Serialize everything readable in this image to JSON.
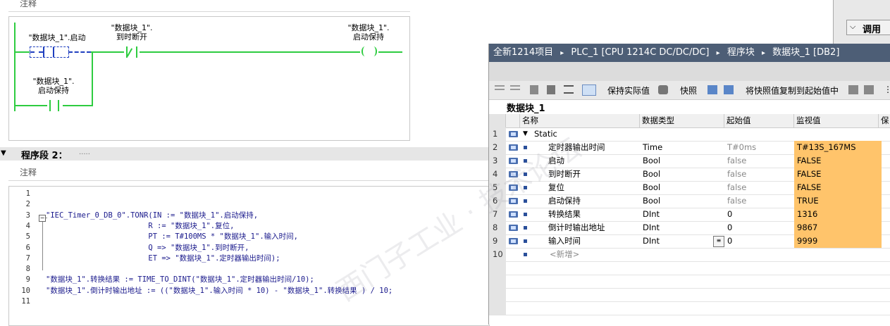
{
  "segment1": {
    "comment_label": "注释",
    "contact_start_l1": "\"数据块_1\".启动",
    "contact_stop_l1": "\"数据块_1\".",
    "contact_stop_l2": "到时断开",
    "coil_l1": "\"数据块_1\".",
    "coil_l2": "启动保持",
    "branch_l1": "\"数据块_1\".",
    "branch_l2": "启动保持"
  },
  "segment2": {
    "title": "程序段 2：",
    "title_suffix": ".....",
    "comment_label": "注释",
    "code_lines": [
      {
        "num": "1",
        "text": ""
      },
      {
        "num": "2",
        "text": ""
      },
      {
        "num": "3",
        "text": "\"IEC_Timer_0_DB_0\".TONR(IN := \"数据块_1\".启动保持,"
      },
      {
        "num": "4",
        "text": "                       R := \"数据块_1\".复位,"
      },
      {
        "num": "5",
        "text": "                       PT := T#100MS * \"数据块_1\".输入时间,"
      },
      {
        "num": "6",
        "text": "                       Q => \"数据块_1\".到时断开,"
      },
      {
        "num": "7",
        "text": "                       ET => \"数据块_1\".定时器输出时间);"
      },
      {
        "num": "8",
        "text": ""
      },
      {
        "num": "9",
        "text": "\"数据块_1\".转换结果 := TIME_TO_DINT(\"数据块_1\".定时器输出时间/10);"
      },
      {
        "num": "10",
        "text": "\"数据块_1\".倒计时输出地址 := ((\"数据块_1\".输入时间 * 10) - \"数据块_1\".转换结果 ) / 10;"
      },
      {
        "num": "11",
        "text": ""
      }
    ]
  },
  "top_right": {
    "label": "调用"
  },
  "db_window": {
    "breadcrumb": [
      "全新1214项目",
      "PLC_1 [CPU 1214C DC/DC/DC]",
      "程序块",
      "数据块_1 [DB2]"
    ],
    "toolbar": {
      "keep_actual": "保持实际值",
      "snapshot": "快照",
      "copy_snapshot": "将快照值复制到起始值中"
    },
    "db_name": "数据块_1",
    "headers": {
      "name": "名称",
      "type": "数据类型",
      "start": "起始值",
      "monitor": "监视值",
      "retain": "保"
    },
    "rows": [
      {
        "num": "1",
        "name": "Static",
        "type": "",
        "start": "",
        "monitor": ""
      },
      {
        "num": "2",
        "name": "定时器输出时间",
        "type": "Time",
        "start": "T#0ms",
        "monitor": "T#13S_167MS"
      },
      {
        "num": "3",
        "name": "启动",
        "type": "Bool",
        "start": "false",
        "monitor": "FALSE"
      },
      {
        "num": "4",
        "name": "到时断开",
        "type": "Bool",
        "start": "false",
        "monitor": "FALSE"
      },
      {
        "num": "5",
        "name": "复位",
        "type": "Bool",
        "start": "false",
        "monitor": "FALSE"
      },
      {
        "num": "6",
        "name": "启动保持",
        "type": "Bool",
        "start": "false",
        "monitor": "TRUE"
      },
      {
        "num": "7",
        "name": "转换结果",
        "type": "DInt",
        "start": "0",
        "monitor": "1316"
      },
      {
        "num": "8",
        "name": "倒计时输出地址",
        "type": "DInt",
        "start": "0",
        "monitor": "9867"
      },
      {
        "num": "9",
        "name": "输入时间",
        "type": "DInt",
        "start": "0",
        "monitor": "9999"
      },
      {
        "num": "10",
        "name": "<新增>",
        "type": "",
        "start": "",
        "monitor": ""
      }
    ]
  },
  "colors": {
    "title_bar": "#4d5e76",
    "monitor_cell": "#ffc46b",
    "ladder_wire": "#2ecc40"
  }
}
